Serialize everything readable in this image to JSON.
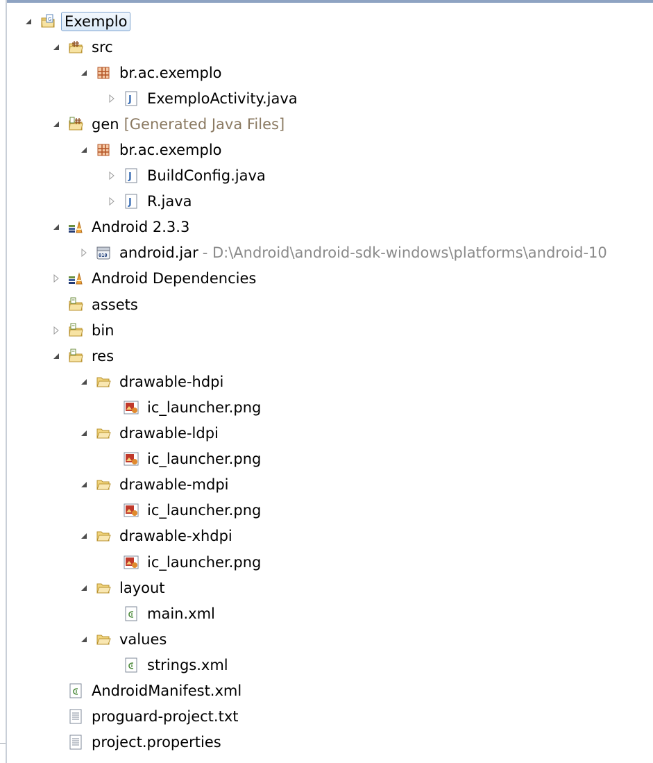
{
  "tree": [
    {
      "depth": 0,
      "twisty": "expanded",
      "icon": "project-icon",
      "label": "Exemplo",
      "selected": true
    },
    {
      "depth": 1,
      "twisty": "expanded",
      "icon": "source-folder-icon",
      "label": "src"
    },
    {
      "depth": 2,
      "twisty": "expanded",
      "icon": "package-icon",
      "label": "br.ac.exemplo"
    },
    {
      "depth": 3,
      "twisty": "collapsed",
      "icon": "java-file-icon",
      "label": "ExemploActivity.java"
    },
    {
      "depth": 1,
      "twisty": "expanded",
      "icon": "generated-folder-icon",
      "label": "gen",
      "decoration": "[Generated Java Files]"
    },
    {
      "depth": 2,
      "twisty": "expanded",
      "icon": "package-icon",
      "label": "br.ac.exemplo"
    },
    {
      "depth": 3,
      "twisty": "collapsed",
      "icon": "java-file-icon",
      "label": "BuildConfig.java"
    },
    {
      "depth": 3,
      "twisty": "collapsed",
      "icon": "java-file-icon",
      "label": "R.java"
    },
    {
      "depth": 1,
      "twisty": "expanded",
      "icon": "library-icon",
      "label": "Android 2.3.3"
    },
    {
      "depth": 2,
      "twisty": "collapsed",
      "icon": "jar-icon",
      "label": "android.jar",
      "path": "- D:\\Android\\android-sdk-windows\\platforms\\android-10"
    },
    {
      "depth": 1,
      "twisty": "collapsed",
      "icon": "library-icon",
      "label": "Android Dependencies"
    },
    {
      "depth": 1,
      "twisty": "none",
      "icon": "folder-icon",
      "label": "assets"
    },
    {
      "depth": 1,
      "twisty": "collapsed",
      "icon": "folder-icon",
      "label": "bin"
    },
    {
      "depth": 1,
      "twisty": "expanded",
      "icon": "folder-icon",
      "label": "res"
    },
    {
      "depth": 2,
      "twisty": "expanded",
      "icon": "open-folder-icon",
      "label": "drawable-hdpi"
    },
    {
      "depth": 3,
      "twisty": "none",
      "icon": "image-file-icon",
      "label": "ic_launcher.png"
    },
    {
      "depth": 2,
      "twisty": "expanded",
      "icon": "open-folder-icon",
      "label": "drawable-ldpi"
    },
    {
      "depth": 3,
      "twisty": "none",
      "icon": "image-file-icon",
      "label": "ic_launcher.png"
    },
    {
      "depth": 2,
      "twisty": "expanded",
      "icon": "open-folder-icon",
      "label": "drawable-mdpi"
    },
    {
      "depth": 3,
      "twisty": "none",
      "icon": "image-file-icon",
      "label": "ic_launcher.png"
    },
    {
      "depth": 2,
      "twisty": "expanded",
      "icon": "open-folder-icon",
      "label": "drawable-xhdpi"
    },
    {
      "depth": 3,
      "twisty": "none",
      "icon": "image-file-icon",
      "label": "ic_launcher.png"
    },
    {
      "depth": 2,
      "twisty": "expanded",
      "icon": "open-folder-icon",
      "label": "layout"
    },
    {
      "depth": 3,
      "twisty": "none",
      "icon": "xml-file-icon",
      "label": "main.xml"
    },
    {
      "depth": 2,
      "twisty": "expanded",
      "icon": "open-folder-icon",
      "label": "values"
    },
    {
      "depth": 3,
      "twisty": "none",
      "icon": "xml-file-icon",
      "label": "strings.xml"
    },
    {
      "depth": 1,
      "twisty": "none",
      "icon": "xml-file-icon",
      "label": "AndroidManifest.xml"
    },
    {
      "depth": 1,
      "twisty": "none",
      "icon": "text-file-icon",
      "label": "proguard-project.txt"
    },
    {
      "depth": 1,
      "twisty": "none",
      "icon": "text-file-icon",
      "label": "project.properties"
    }
  ]
}
